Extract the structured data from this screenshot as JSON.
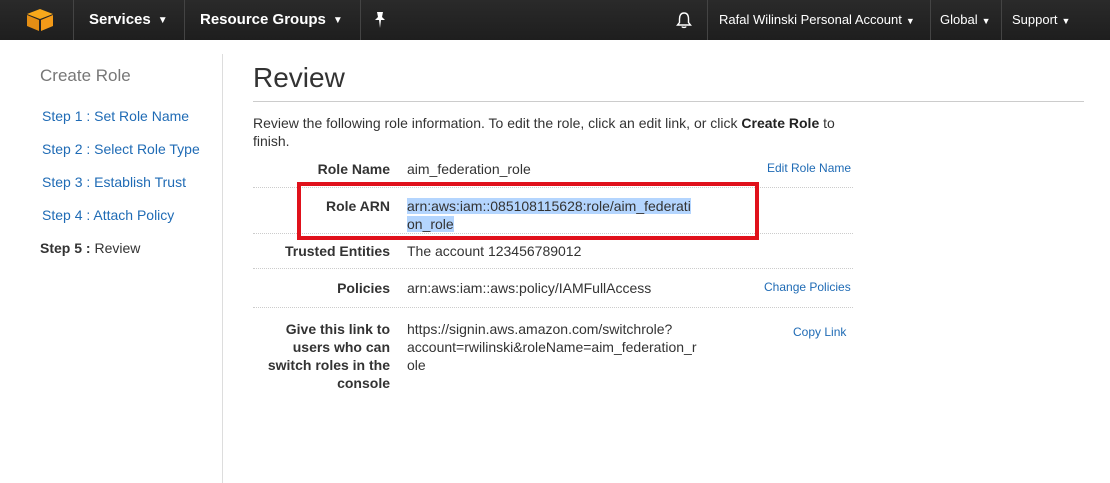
{
  "topnav": {
    "services_label": "Services",
    "resource_groups_label": "Resource Groups",
    "account_label": "Rafal Wilinski Personal Account",
    "region_label": "Global",
    "support_label": "Support",
    "caret_glyph": "▼",
    "bg_color": "#222222",
    "logo_color": "#f90"
  },
  "sidebar": {
    "title": "Create Role",
    "steps": [
      {
        "label": "Step 1 : Set Role Name"
      },
      {
        "label": "Step 2 : Select Role Type"
      },
      {
        "label": "Step 3 : Establish Trust"
      },
      {
        "label": "Step 4 : Attach Policy"
      },
      {
        "prefix": "Step 5 :",
        "label": "Review"
      }
    ]
  },
  "main": {
    "title": "Review",
    "intro_pre": "Review the following role information. To edit the role, click an edit link, or click ",
    "intro_bold": "Create Role",
    "intro_post": " to finish.",
    "rows": [
      {
        "label": "Role Name",
        "value": "aim_federation_role",
        "link": "Edit Role Name"
      },
      {
        "label": "Role ARN",
        "value_line1": "arn:aws:iam::085108115628:role/aim_federati",
        "value_line2": "on_role"
      },
      {
        "label": "Trusted Entities",
        "value": "The account 123456789012"
      },
      {
        "label": "Policies",
        "value": "arn:aws:iam::aws:policy/IAMFullAccess",
        "link": "Change Policies"
      },
      {
        "label_lines": [
          "Give this link to",
          "users who can",
          "switch roles in the",
          "console"
        ],
        "value_lines": [
          "https://signin.aws.amazon.com/switchrole?",
          "account=rwilinski&roleName=aim_federation_r",
          "ole"
        ],
        "link": "Copy Link"
      }
    ]
  },
  "annotation_color": "#e0111b",
  "link_color": "#1f6bb5"
}
